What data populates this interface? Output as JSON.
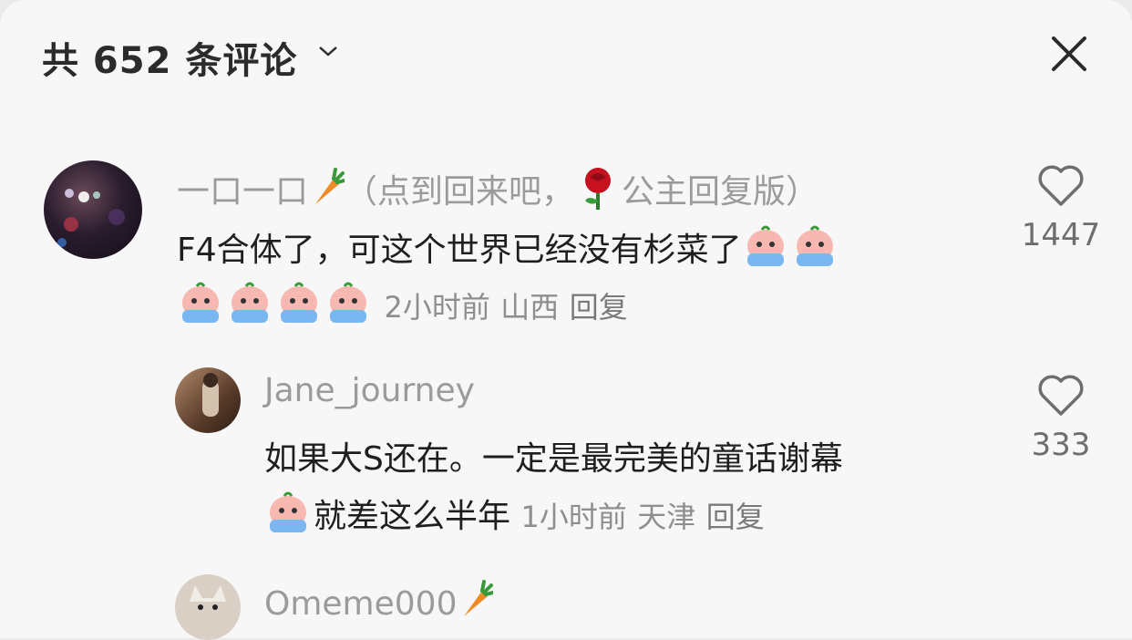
{
  "header": {
    "title": "共 652 条评论",
    "chevron_icon": "chevron-down-icon",
    "close_icon": "close-icon"
  },
  "comments": [
    {
      "username": "一口一口",
      "username_suffix_open": "（点到回来吧，",
      "username_suffix_close": "公主回复版）",
      "text": "F4合体了，可这个世界已经没有杉菜了",
      "time": "2小时前",
      "location": "山西",
      "reply_label": "回复",
      "likes": "1447"
    },
    {
      "username": "Jane_journey",
      "text": "如果大S还在。一定是最完美的童话谢幕",
      "text_after_emoji": "就差这么半年",
      "time": "1小时前",
      "location": "天津",
      "reply_label": "回复",
      "likes": "333"
    },
    {
      "username": "Omeme000"
    }
  ],
  "colors": {
    "background": "#f7f7f7",
    "username": "#9b9b9b",
    "text": "#1f1f1f",
    "meta": "#8e8e8e"
  }
}
